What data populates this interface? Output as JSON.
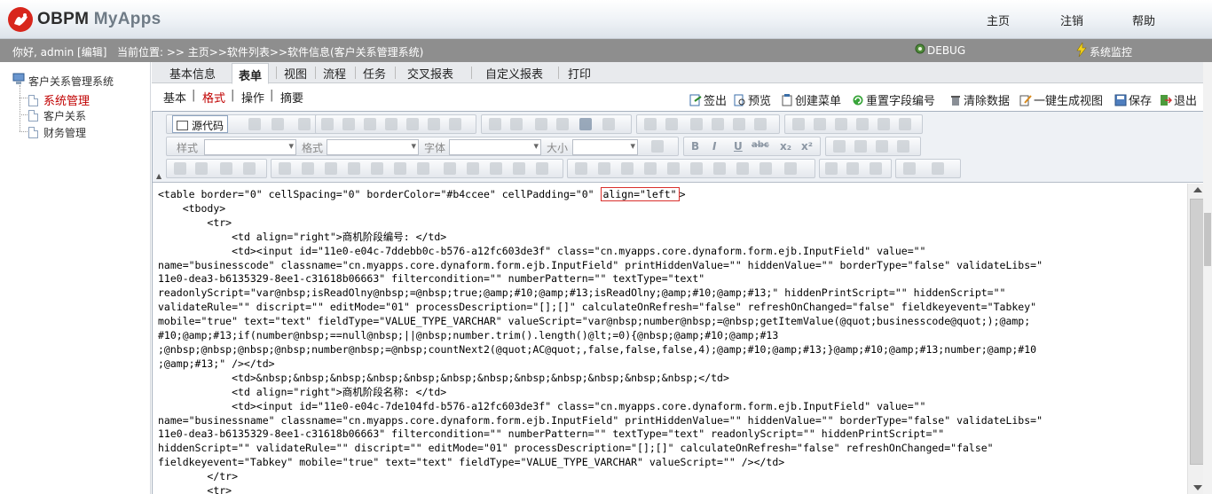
{
  "app": {
    "logo_name": "OBPM",
    "logo_suffix": "MyApps"
  },
  "topnav": {
    "home": "主页",
    "logout": "注销",
    "help": "帮助"
  },
  "status": {
    "greeting": "你好, admin [编辑]",
    "location": "当前位置: >> 主页>>软件列表>>软件信息(客户关系管理系统)",
    "debug": "DEBUG",
    "monitor": "系统监控"
  },
  "tree": {
    "root": "客户关系管理系统",
    "items": [
      "系统管理",
      "客户关系",
      "财务管理"
    ]
  },
  "tabs": [
    "基本信息",
    "表单",
    "视图",
    "流程",
    "任务",
    "交叉报表",
    "自定义报表",
    "打印"
  ],
  "active_tab": "表单",
  "subtabs": [
    "基本",
    "格式",
    "操作",
    "摘要"
  ],
  "active_subtab": "格式",
  "actions": [
    "签出",
    "预览",
    "创建菜单",
    "重置字段编号",
    "清除数据",
    "一键生成视图",
    "保存",
    "退出"
  ],
  "toolbar": {
    "source_label": "源代码",
    "style_label": "样式",
    "format_label": "格式",
    "font_label": "字体",
    "size_label": "大小",
    "bold": "B",
    "italic": "I",
    "underline": "U",
    "strike": "abc",
    "subscript": "x₂",
    "superscript": "x²"
  },
  "code": {
    "line1_pre": "<table border=\"0\" cellSpacing=\"0\" borderColor=\"#b4ccee\" cellPadding=\"0\" ",
    "line1_highlight": "align=\"left\"",
    "line1_post": ">",
    "body": "    <tbody>\n        <tr>\n            <td align=\"right\">商机阶段编号: </td>\n            <td><input id=\"11e0-e04c-7ddebb0c-b576-a12fc603de3f\" class=\"cn.myapps.core.dynaform.form.ejb.InputField\" value=\"\"\nname=\"businesscode\" classname=\"cn.myapps.core.dynaform.form.ejb.InputField\" printHiddenValue=\"\" hiddenValue=\"\" borderType=\"false\" validateLibs=\"\n11e0-dea3-b6135329-8ee1-c31618b06663\" filtercondition=\"\" numberPattern=\"\" textType=\"text\"\nreadonlyScript=\"var@nbsp;isReadOlny@nbsp;=@nbsp;true;@amp;#10;@amp;#13;isReadOlny;@amp;#10;@amp;#13;\" hiddenPrintScript=\"\" hiddenScript=\"\"\nvalidateRule=\"\" discript=\"\" editMode=\"01\" processDescription=\"[];[]\" calculateOnRefresh=\"false\" refreshOnChanged=\"false\" fieldkeyevent=\"Tabkey\"\nmobile=\"true\" text=\"text\" fieldType=\"VALUE_TYPE_VARCHAR\" valueScript=\"var@nbsp;number@nbsp;=@nbsp;getItemValue(@quot;businesscode@quot;);@amp;\n#10;@amp;#13;if(number@nbsp;==null@nbsp;||@nbsp;number.trim().length()@lt;=0){@nbsp;@amp;#10;@amp;#13\n;@nbsp;@nbsp;@nbsp;@nbsp;number@nbsp;=@nbsp;countNext2(@quot;AC@quot;,false,false,false,4);@amp;#10;@amp;#13;}@amp;#10;@amp;#13;number;@amp;#10\n;@amp;#13;\" /></td>\n            <td>&nbsp;&nbsp;&nbsp;&nbsp;&nbsp;&nbsp;&nbsp;&nbsp;&nbsp;&nbsp;&nbsp;&nbsp;</td>\n            <td align=\"right\">商机阶段名称: </td>\n            <td><input id=\"11e0-e04c-7de104fd-b576-a12fc603de3f\" class=\"cn.myapps.core.dynaform.form.ejb.InputField\" value=\"\"\nname=\"businessname\" classname=\"cn.myapps.core.dynaform.form.ejb.InputField\" printHiddenValue=\"\" hiddenValue=\"\" borderType=\"false\" validateLibs=\"\n11e0-dea3-b6135329-8ee1-c31618b06663\" filtercondition=\"\" numberPattern=\"\" textType=\"text\" readonlyScript=\"\" hiddenPrintScript=\"\"\nhiddenScript=\"\" validateRule=\"\" discript=\"\" editMode=\"01\" processDescription=\"[];[]\" calculateOnRefresh=\"false\" refreshOnChanged=\"false\"\nfieldkeyevent=\"Tabkey\" mobile=\"true\" text=\"text\" fieldType=\"VALUE_TYPE_VARCHAR\" valueScript=\"\" /></td>\n        </tr>\n        <tr>"
  },
  "colors": {
    "highlight_border": "#d9302c",
    "status_bg": "#8e8e8e",
    "active_subtab": "#c00000"
  }
}
